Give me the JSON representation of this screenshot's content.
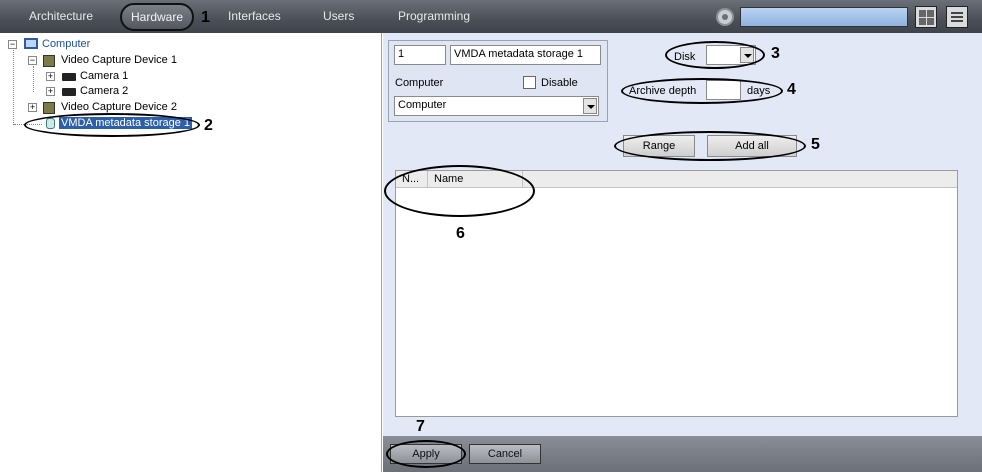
{
  "topbar": {
    "tabs": [
      "Architecture",
      "Hardware",
      "Interfaces",
      "Users",
      "Programming"
    ],
    "search_value": ""
  },
  "tree": {
    "computer": "Computer",
    "device1": "Video Capture Device 1",
    "camera1": "Camera 1",
    "camera2": "Camera 2",
    "device2": "Video Capture Device 2",
    "storage": "VMDA metadata storage 1"
  },
  "form": {
    "id_value": "1",
    "name_value": "VMDA metadata storage 1",
    "computer_label": "Computer",
    "disable_label": "Disable",
    "computer_select": "Computer",
    "disk_label": "Disk",
    "disk_value": "",
    "archive_depth_label": "Archive depth",
    "archive_depth_value": "",
    "days_label": "days",
    "range_button": "Range",
    "add_all_button": "Add all"
  },
  "table": {
    "columns": [
      "N...",
      "Name"
    ],
    "rows": []
  },
  "footer": {
    "apply_button": "Apply",
    "cancel_button": "Cancel"
  },
  "annotations": [
    "1",
    "2",
    "3",
    "4",
    "5",
    "6",
    "7"
  ],
  "colors": {
    "topbar": "#4b5058",
    "panel": "#e2e8f5",
    "selection": "#2c5fa8",
    "search": "#a6c4ea"
  }
}
